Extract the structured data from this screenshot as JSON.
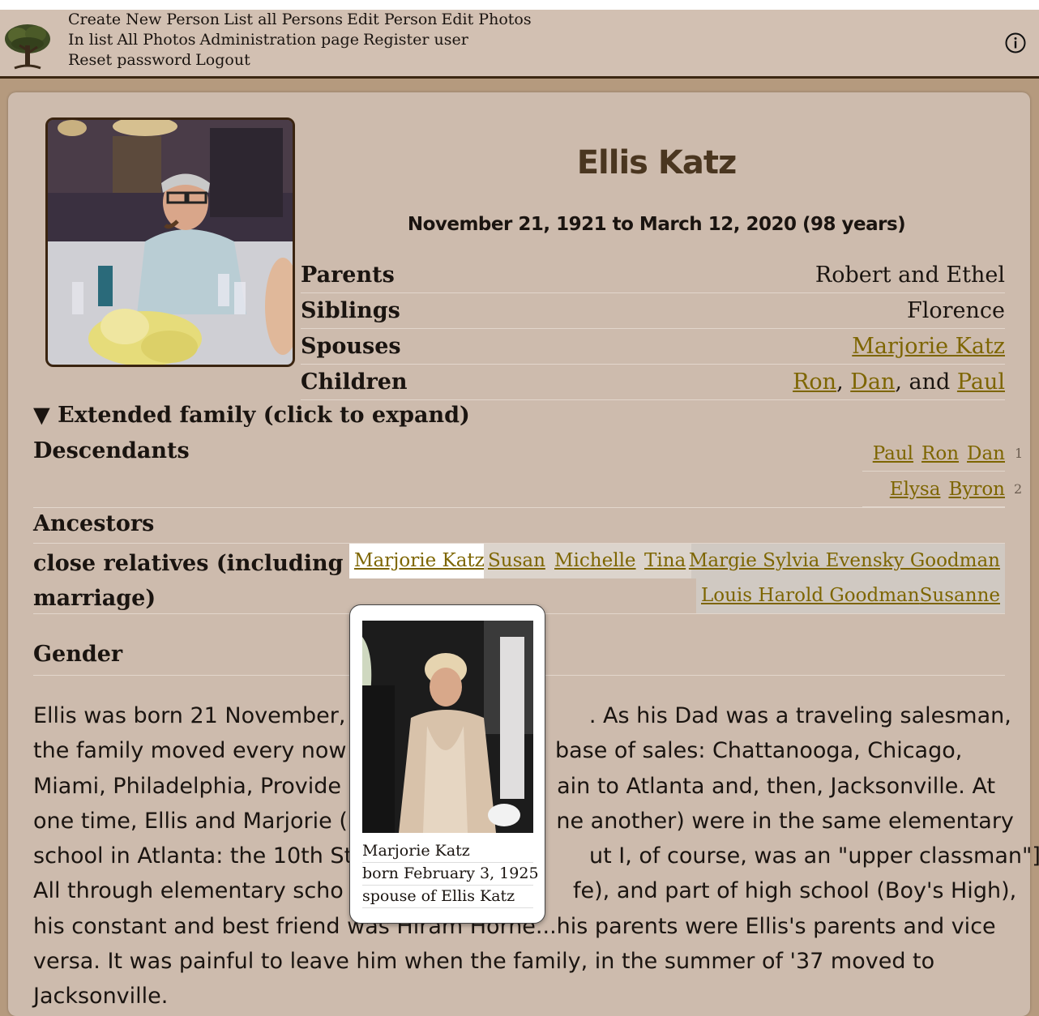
{
  "nav": {
    "line1": [
      "Create New Person",
      "List all Persons",
      "Edit Person",
      "Edit Photos"
    ],
    "line2": [
      "In list",
      "All Photos",
      "Administration page",
      "Register user"
    ],
    "line3": [
      "Reset password",
      "Logout"
    ]
  },
  "person": {
    "name": "Ellis Katz",
    "dates": "November 21, 1921 to March 12, 2020 (98 years)"
  },
  "facts": {
    "parents_label": "Parents",
    "parents_value": "Robert and Ethel",
    "siblings_label": "Siblings",
    "siblings_value": "Florence",
    "spouses_label": "Spouses",
    "spouse_link": "Marjorie Katz",
    "children_label": "Children",
    "children": [
      "Ron",
      "Dan",
      "Paul"
    ],
    "children_sep1": ", ",
    "children_sep2": ", and "
  },
  "extended": {
    "toggle": "▼ Extended family (click to expand)",
    "descendants_label": "Descendants",
    "gen1": [
      "Paul",
      "Ron",
      "Dan"
    ],
    "gen1_num": "1",
    "gen2": [
      "Elysa",
      "Byron"
    ],
    "gen2_num": "2",
    "ancestors_label": "Ancestors",
    "close_label_1": "close relatives (including",
    "close_label_2": "marriage)",
    "close_row1": [
      "Marjorie Katz",
      "Susan",
      "Michelle",
      "Tina",
      "Margie Sylvia Evensky Goodman"
    ],
    "close_row2": [
      "Louis Harold Goodman",
      "Susanne"
    ],
    "gender_label": "Gender"
  },
  "bio": {
    "lines": [
      "Ellis was born 21 November,                                   . As his Dad was a traveling salesman,",
      "the family moved every now                              base of sales: Chattanooga, Chicago,",
      "Miami, Philadelphia, Provide                               ain to Atlanta and, then, Jacksonville. At",
      "one time, Ellis and Marjorie (                              ne another) were in the same elementary",
      "school in Atlanta: the 10th St                                  ut I, of course, was an \"upper classman\"]",
      "All through elementary scho                                 fe), and part of high school (Boy's High),",
      "his constant and best friend was Hiram Horne...his parents were Ellis's parents and vice",
      "versa. It was painful to leave him when the family, in the summer of '37 moved to",
      "Jacksonville."
    ]
  },
  "popup": {
    "name": "Marjorie Katz",
    "born": "born February 3, 1925",
    "relation": "spouse of Ellis Katz"
  },
  "colors": {
    "link": "#7d6500",
    "card": "#cdbbad",
    "highlight_light": "#dcd4cc",
    "highlight_dark": "#d0c9c2"
  }
}
